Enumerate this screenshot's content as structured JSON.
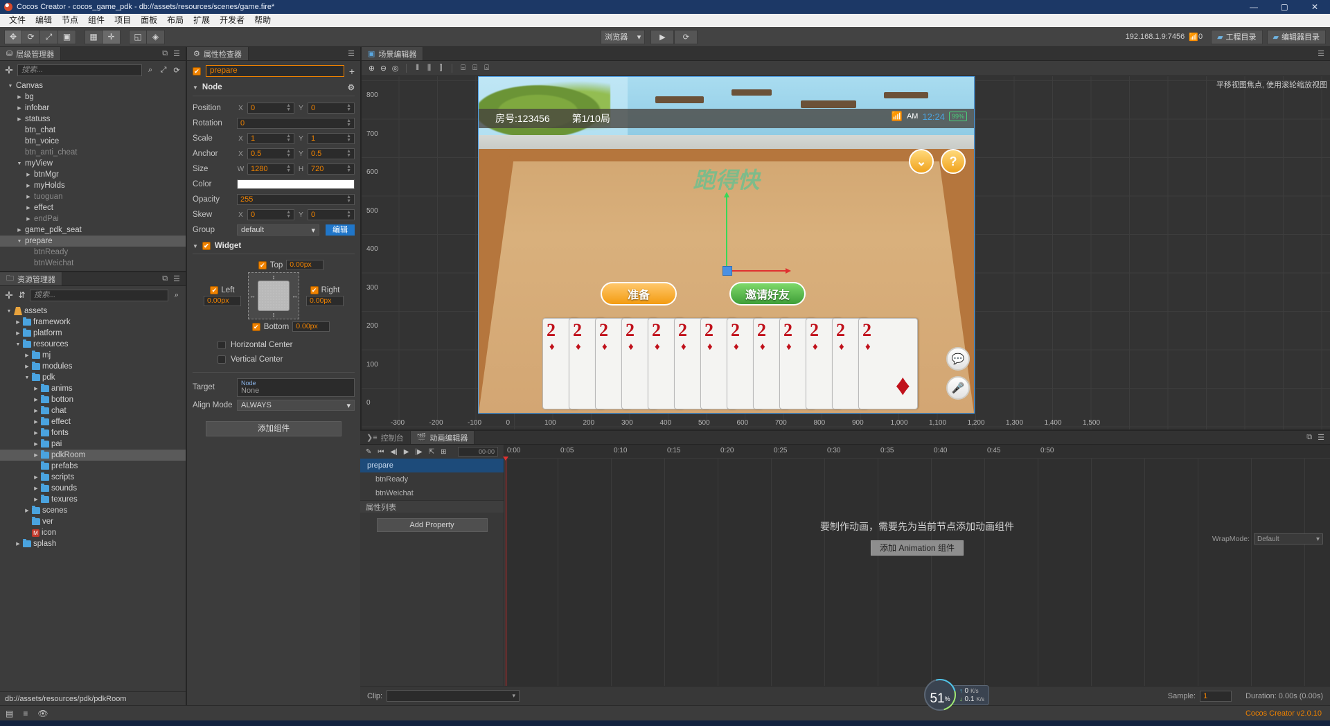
{
  "window": {
    "title": "Cocos Creator - cocos_game_pdk - db://assets/resources/scenes/game.fire*",
    "minimize": "—",
    "maximize": "▢",
    "close": "✕"
  },
  "menu": [
    "文件",
    "编辑",
    "节点",
    "组件",
    "项目",
    "面板",
    "布局",
    "扩展",
    "开发者",
    "帮助"
  ],
  "toolbar": {
    "transform_tools": [
      "✥",
      "⟳",
      "⤢",
      "▣"
    ],
    "align_tools": [
      "▦",
      "✛"
    ],
    "anchor_tools": [
      "◱",
      "◈"
    ],
    "browser_select": "浏览器",
    "play_label": "▶",
    "refresh_label": "⟳",
    "ip_address": "192.168.1.9:7456",
    "connections": "0",
    "project_dir_button": "工程目录",
    "editor_dir_button": "编辑器目录"
  },
  "hierarchy": {
    "tab": "层级管理器",
    "search_placeholder": "搜索...",
    "nodes": [
      {
        "label": "Canvas",
        "depth": 0,
        "arrow": "down",
        "dim": false,
        "selected": false
      },
      {
        "label": "bg",
        "depth": 1,
        "arrow": "right",
        "dim": false,
        "selected": false
      },
      {
        "label": "infobar",
        "depth": 1,
        "arrow": "right",
        "dim": false,
        "selected": false
      },
      {
        "label": "statuss",
        "depth": 1,
        "arrow": "right",
        "dim": false,
        "selected": false
      },
      {
        "label": "btn_chat",
        "depth": 1,
        "arrow": "none",
        "dim": false,
        "selected": false
      },
      {
        "label": "btn_voice",
        "depth": 1,
        "arrow": "none",
        "dim": false,
        "selected": false
      },
      {
        "label": "btn_anti_cheat",
        "depth": 1,
        "arrow": "none",
        "dim": true,
        "selected": false
      },
      {
        "label": "myView",
        "depth": 1,
        "arrow": "down",
        "dim": false,
        "selected": false
      },
      {
        "label": "btnMgr",
        "depth": 2,
        "arrow": "right",
        "dim": false,
        "selected": false
      },
      {
        "label": "myHolds",
        "depth": 2,
        "arrow": "right",
        "dim": false,
        "selected": false
      },
      {
        "label": "tuoguan",
        "depth": 2,
        "arrow": "right",
        "dim": true,
        "selected": false
      },
      {
        "label": "effect",
        "depth": 2,
        "arrow": "right",
        "dim": false,
        "selected": false
      },
      {
        "label": "endPai",
        "depth": 2,
        "arrow": "right",
        "dim": true,
        "selected": false
      },
      {
        "label": "game_pdk_seat",
        "depth": 1,
        "arrow": "right",
        "dim": false,
        "selected": false
      },
      {
        "label": "prepare",
        "depth": 1,
        "arrow": "down",
        "dim": false,
        "selected": true
      },
      {
        "label": "btnReady",
        "depth": 2,
        "arrow": "none",
        "dim": true,
        "selected": false
      },
      {
        "label": "btnWeichat",
        "depth": 2,
        "arrow": "none",
        "dim": true,
        "selected": false
      }
    ]
  },
  "assets": {
    "tab": "资源管理器",
    "search_placeholder": "搜索...",
    "path_bar": "db://assets/resources/pdk/pdkRoom",
    "nodes": [
      {
        "label": "assets",
        "depth": 0,
        "arrow": "down",
        "icon": "assets",
        "selected": false
      },
      {
        "label": "framework",
        "depth": 1,
        "arrow": "right",
        "icon": "folder",
        "selected": false
      },
      {
        "label": "platform",
        "depth": 1,
        "arrow": "right",
        "icon": "folder",
        "selected": false
      },
      {
        "label": "resources",
        "depth": 1,
        "arrow": "down",
        "icon": "folder",
        "selected": false
      },
      {
        "label": "mj",
        "depth": 2,
        "arrow": "right",
        "icon": "folder",
        "selected": false
      },
      {
        "label": "modules",
        "depth": 2,
        "arrow": "right",
        "icon": "folder",
        "selected": false
      },
      {
        "label": "pdk",
        "depth": 2,
        "arrow": "down",
        "icon": "folder",
        "selected": false
      },
      {
        "label": "anims",
        "depth": 3,
        "arrow": "right",
        "icon": "folder",
        "selected": false
      },
      {
        "label": "botton",
        "depth": 3,
        "arrow": "right",
        "icon": "folder",
        "selected": false
      },
      {
        "label": "chat",
        "depth": 3,
        "arrow": "right",
        "icon": "folder",
        "selected": false
      },
      {
        "label": "effect",
        "depth": 3,
        "arrow": "right",
        "icon": "folder",
        "selected": false
      },
      {
        "label": "fonts",
        "depth": 3,
        "arrow": "right",
        "icon": "folder",
        "selected": false
      },
      {
        "label": "pai",
        "depth": 3,
        "arrow": "right",
        "icon": "folder",
        "selected": false
      },
      {
        "label": "pdkRoom",
        "depth": 3,
        "arrow": "right",
        "icon": "folder",
        "selected": true
      },
      {
        "label": "prefabs",
        "depth": 3,
        "arrow": "none",
        "icon": "folder",
        "selected": false
      },
      {
        "label": "scripts",
        "depth": 3,
        "arrow": "right",
        "icon": "folder",
        "selected": false
      },
      {
        "label": "sounds",
        "depth": 3,
        "arrow": "right",
        "icon": "folder",
        "selected": false
      },
      {
        "label": "texures",
        "depth": 3,
        "arrow": "right",
        "icon": "folder",
        "selected": false
      },
      {
        "label": "scenes",
        "depth": 2,
        "arrow": "right",
        "icon": "folder",
        "selected": false
      },
      {
        "label": "ver",
        "depth": 2,
        "arrow": "none",
        "icon": "folder",
        "selected": false
      },
      {
        "label": "icon",
        "depth": 2,
        "arrow": "none",
        "icon": "script",
        "selected": false
      },
      {
        "label": "splash",
        "depth": 1,
        "arrow": "right",
        "icon": "folder",
        "selected": false
      }
    ]
  },
  "inspector": {
    "tab": "属性检查器",
    "node_enabled": "✔",
    "node_name": "prepare",
    "add_component_plus": "+",
    "node_section": {
      "title": "Node",
      "position_label": "Position",
      "position_x": "0",
      "position_y": "0",
      "rotation_label": "Rotation",
      "rotation": "0",
      "scale_label": "Scale",
      "scale_x": "1",
      "scale_y": "1",
      "anchor_label": "Anchor",
      "anchor_x": "0.5",
      "anchor_y": "0.5",
      "size_label": "Size",
      "size_w": "1280",
      "size_h": "720",
      "color_label": "Color",
      "color_value": "#FFFFFF",
      "opacity_label": "Opacity",
      "opacity": "255",
      "skew_label": "Skew",
      "skew_x": "0",
      "skew_y": "0",
      "group_label": "Group",
      "group_value": "default",
      "group_edit": "编辑",
      "axis_x": "X",
      "axis_y": "Y",
      "axis_w": "W",
      "axis_h": "H"
    },
    "widget_section": {
      "title": "Widget",
      "enabled": "✔",
      "top_label": "Top",
      "top_value": "0.00px",
      "left_label": "Left",
      "left_value": "0.00px",
      "right_label": "Right",
      "right_value": "0.00px",
      "bottom_label": "Bottom",
      "bottom_value": "0.00px",
      "horizontal_center": "Horizontal Center",
      "vertical_center": "Vertical Center",
      "target_label": "Target",
      "target_type": "Node",
      "target_value": "None",
      "align_mode_label": "Align Mode",
      "align_mode_value": "ALWAYS"
    },
    "add_component_button": "添加组件"
  },
  "scene": {
    "tab": "场景编辑器",
    "toolbar_icons": [
      "⊕",
      "⊖",
      "◎",
      "⫴",
      "⫼",
      "⫿",
      "⌸",
      "⌹",
      "⌺"
    ],
    "hint": "平移视图焦点, 使用滚轮缩放视图",
    "ruler_y": [
      "800",
      "700",
      "600",
      "500",
      "400",
      "300",
      "200",
      "100",
      "0"
    ],
    "ruler_x": [
      "-300",
      "-200",
      "-100",
      "0",
      "100",
      "200",
      "300",
      "400",
      "500",
      "600",
      "700",
      "800",
      "900",
      "1,000",
      "1,100",
      "1,200",
      "1,300",
      "1,400",
      "1,500"
    ],
    "game": {
      "room_label": "房号:123456",
      "round_label": "第1/10局",
      "status_ampm": "AM",
      "status_time": "12:24",
      "status_battery": "99%",
      "logo_text": "跑得快",
      "ready_button": "准备",
      "invite_button": "邀请好友",
      "card_rank": "2",
      "card_suit": "♦",
      "card_count": 13,
      "chat_icon": "💬",
      "mic_icon": "🎤",
      "collapse_icon": "⌄",
      "help_icon": "?"
    }
  },
  "bottom": {
    "console_tab": "控制台",
    "anim_tab": "动画编辑器",
    "controls": [
      "✎",
      "⏮",
      "◀|",
      "▶",
      "|▶",
      "⇱",
      "⊞"
    ],
    "timecode": "00-00",
    "nodes": [
      {
        "label": "prepare",
        "selected": true,
        "child": false
      },
      {
        "label": "btnReady",
        "selected": false,
        "child": true
      },
      {
        "label": "btnWeichat",
        "selected": false,
        "child": true
      }
    ],
    "property_list_label": "属性列表",
    "add_property_button": "Add Property",
    "ruler": [
      "0:00",
      "0:05",
      "0:10",
      "0:15",
      "0:20",
      "0:25",
      "0:30",
      "0:35",
      "0:40",
      "0:45",
      "0:50"
    ],
    "message": "要制作动画，需要先为当前节点添加动画组件",
    "add_animation_button": "添加 Animation 组件",
    "wrapmode_label": "WrapMode:",
    "wrapmode_value": "Default",
    "clip_label": "Clip:",
    "clip_value": "",
    "sample_label": "Sample:",
    "sample_value": "1",
    "duration_label": "Duration: 0.00s (0.00s)"
  },
  "statusbar": {
    "icons": [
      "▤",
      "≡",
      "👁"
    ],
    "version": "Cocos Creator v2.0.10"
  },
  "perf": {
    "percent": "51",
    "percent_unit": "%",
    "upload": "0",
    "upload_unit": "K/s",
    "download": "0.1",
    "download_unit": "K/s"
  },
  "colors": {
    "accent": "#ef8200",
    "selection": "#1d4b7a",
    "title_bg": "#1c3866"
  }
}
